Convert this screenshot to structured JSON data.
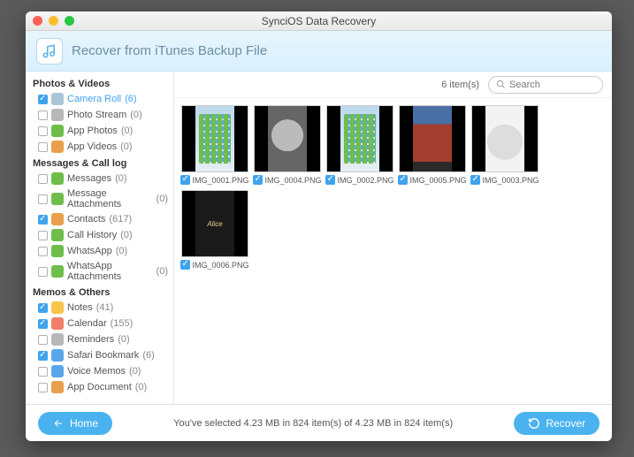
{
  "window": {
    "title": "SynciOS Data Recovery"
  },
  "header": {
    "title": "Recover from iTunes Backup File"
  },
  "sidebar": {
    "groups": [
      {
        "title": "Photos & Videos",
        "items": [
          {
            "label": "Camera Roll",
            "count": "(6)",
            "checked": true,
            "active": true,
            "iconClass": "ic-camera"
          },
          {
            "label": "Photo Stream",
            "count": "(0)",
            "checked": false,
            "iconClass": "ic-pstream"
          },
          {
            "label": "App Photos",
            "count": "(0)",
            "checked": false,
            "iconClass": "ic-appphotos"
          },
          {
            "label": "App Videos",
            "count": "(0)",
            "checked": false,
            "iconClass": "ic-appvideos"
          }
        ]
      },
      {
        "title": "Messages & Call log",
        "items": [
          {
            "label": "Messages",
            "count": "(0)",
            "checked": false,
            "iconClass": "ic-messages"
          },
          {
            "label": "Message Attachments",
            "count": "(0)",
            "checked": false,
            "iconClass": "ic-msgatt"
          },
          {
            "label": "Contacts",
            "count": "(617)",
            "checked": true,
            "iconClass": "ic-contacts"
          },
          {
            "label": "Call History",
            "count": "(0)",
            "checked": false,
            "iconClass": "ic-callhist"
          },
          {
            "label": "WhatsApp",
            "count": "(0)",
            "checked": false,
            "iconClass": "ic-whatsapp"
          },
          {
            "label": "WhatsApp Attachments",
            "count": "(0)",
            "checked": false,
            "iconClass": "ic-whatsatt"
          }
        ]
      },
      {
        "title": "Memos & Others",
        "items": [
          {
            "label": "Notes",
            "count": "(41)",
            "checked": true,
            "iconClass": "ic-notes"
          },
          {
            "label": "Calendar",
            "count": "(155)",
            "checked": true,
            "iconClass": "ic-calendar"
          },
          {
            "label": "Reminders",
            "count": "(0)",
            "checked": false,
            "iconClass": "ic-reminders"
          },
          {
            "label": "Safari Bookmark",
            "count": "(6)",
            "checked": true,
            "iconClass": "ic-safari"
          },
          {
            "label": "Voice Memos",
            "count": "(0)",
            "checked": false,
            "iconClass": "ic-voice"
          },
          {
            "label": "App Document",
            "count": "(0)",
            "checked": false,
            "iconClass": "ic-appdoc"
          }
        ]
      }
    ]
  },
  "content": {
    "count_label": "6 item(s)",
    "search_placeholder": "Search",
    "thumbs": [
      {
        "name": "IMG_0001.PNG",
        "checked": true,
        "thumbClass": "t1"
      },
      {
        "name": "IMG_0004.PNG",
        "checked": true,
        "thumbClass": "t2"
      },
      {
        "name": "IMG_0002.PNG",
        "checked": true,
        "thumbClass": "t3"
      },
      {
        "name": "IMG_0005.PNG",
        "checked": true,
        "thumbClass": "t4"
      },
      {
        "name": "IMG_0003.PNG",
        "checked": true,
        "thumbClass": "t5"
      },
      {
        "name": "IMG_0006.PNG",
        "checked": true,
        "thumbClass": "t6"
      }
    ]
  },
  "footer": {
    "home_label": "Home",
    "status": "You've selected 4.23 MB in 824 item(s) of 4.23 MB in 824 item(s)",
    "recover_label": "Recover"
  }
}
